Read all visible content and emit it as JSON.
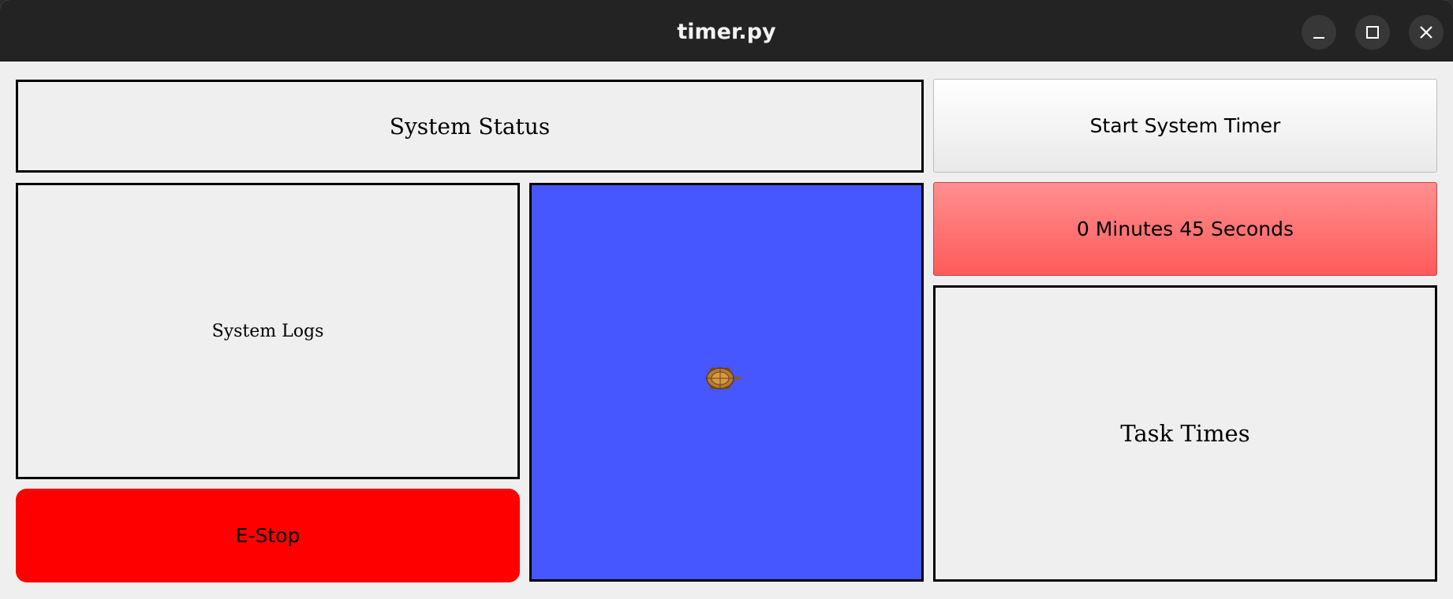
{
  "window": {
    "title": "timer.py",
    "controls": [
      "minimize-icon",
      "maximize-icon",
      "close-icon"
    ]
  },
  "panels": {
    "status": "System Status",
    "logs": "System Logs",
    "tasks": "Task Times"
  },
  "buttons": {
    "start_timer": "Start System Timer",
    "timer_display": "0 Minutes 45 Seconds",
    "estop": "E-Stop"
  },
  "colors": {
    "canvas_background": "#4657ff",
    "estop": "#ff0000",
    "timer": "#ff6b6b"
  },
  "canvas": {
    "sprite": "turtle-icon"
  }
}
